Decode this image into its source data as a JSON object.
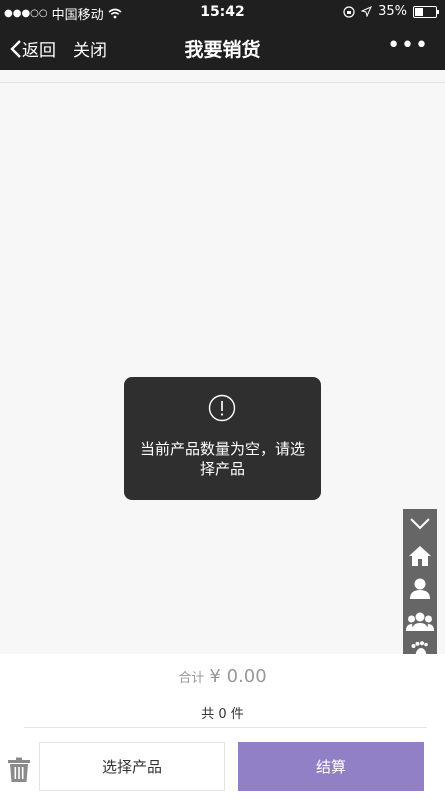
{
  "status": {
    "carrier": "中国移动",
    "time": "15:42",
    "battery": "35%",
    "battery_level": 0.35
  },
  "nav": {
    "back_label": "返回",
    "close_label": "关闭",
    "title": "我要销货",
    "more_label": "•••"
  },
  "toast": {
    "message": "当前产品数量为空，请选择产品"
  },
  "footer": {
    "total_label": "合计",
    "total_amount": "¥ 0.00",
    "count_text": "共 0 件",
    "choose_button": "选择产品",
    "checkout_button": "结算"
  },
  "floatbar": {
    "icons": [
      "chevron-down-icon",
      "home-icon",
      "user-icon",
      "group-icon",
      "footprint-icon",
      "heart-icon",
      "service-icon"
    ]
  },
  "colors": {
    "bar_bg": "#1f1f1f",
    "checkout": "#9180c6",
    "toast_bg": "#2f2f2f"
  }
}
